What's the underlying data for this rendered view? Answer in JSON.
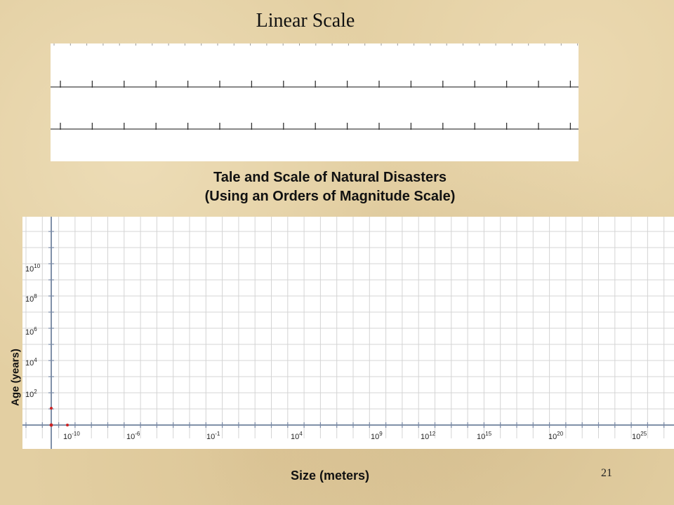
{
  "slide": {
    "title": "Linear Scale",
    "page_number": "21"
  },
  "linear_scale": {
    "rulers": 2,
    "ticks_per_ruler": 17
  },
  "chart_data": {
    "type": "scatter",
    "title": "Tale and Scale of Natural Disasters",
    "subtitle": "(Using an Orders of Magnitude Scale)",
    "xlabel": "Size (meters)",
    "ylabel": "Age (years)",
    "x_scale": "log",
    "y_scale": "log",
    "x_tick_labels": [
      {
        "base": "10",
        "exp": "-10"
      },
      {
        "base": "10",
        "exp": "-6"
      },
      {
        "base": "10",
        "exp": "-1"
      },
      {
        "base": "10",
        "exp": "4"
      },
      {
        "base": "10",
        "exp": "9"
      },
      {
        "base": "10",
        "exp": "12"
      },
      {
        "base": "10",
        "exp": "15"
      },
      {
        "base": "10",
        "exp": "20"
      },
      {
        "base": "10",
        "exp": "25"
      }
    ],
    "y_tick_labels": [
      {
        "base": "10",
        "exp": "10"
      },
      {
        "base": "10",
        "exp": "8"
      },
      {
        "base": "10",
        "exp": "6"
      },
      {
        "base": "10",
        "exp": "4"
      },
      {
        "base": "10",
        "exp": "2"
      }
    ],
    "grid": true,
    "marker_color": "#cc2222"
  }
}
